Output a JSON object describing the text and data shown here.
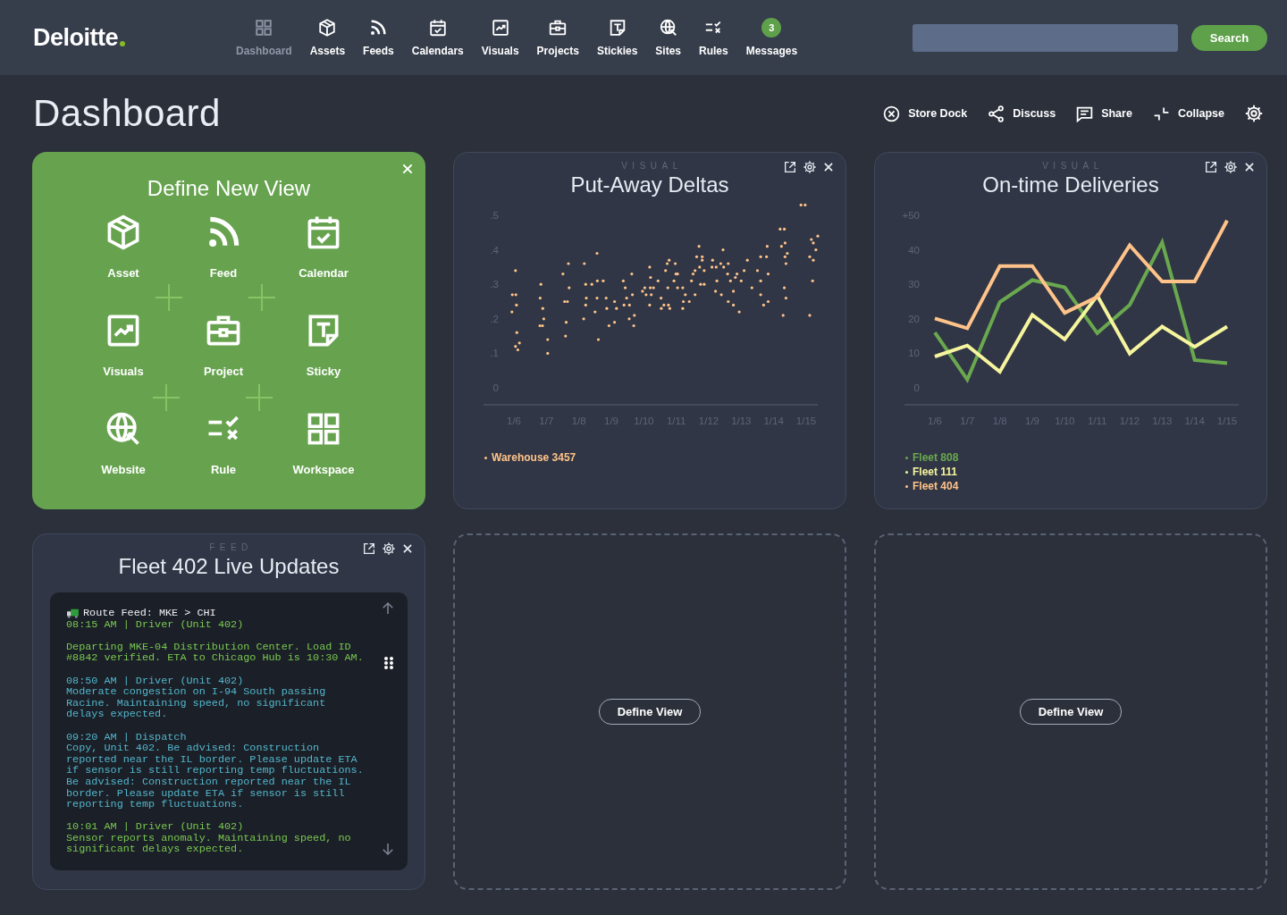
{
  "nav": {
    "logo": "Deloitte",
    "items": [
      {
        "label": "Dashboard",
        "selected": true
      },
      {
        "label": "Assets",
        "selected": false
      },
      {
        "label": "Feeds",
        "selected": false
      },
      {
        "label": "Calendars",
        "selected": false
      },
      {
        "label": "Visuals",
        "selected": false
      },
      {
        "label": "Projects",
        "selected": false
      },
      {
        "label": "Stickies",
        "selected": false
      },
      {
        "label": "Sites",
        "selected": false
      },
      {
        "label": "Rules",
        "selected": false
      },
      {
        "label": "Messages",
        "selected": false,
        "badge": "3"
      }
    ],
    "search_button": "Search"
  },
  "page": {
    "title": "Dashboard",
    "actions": [
      "Store Dock",
      "Discuss",
      "Share",
      "Collapse"
    ]
  },
  "cards": [
    {
      "kind": "picker",
      "title": "Define New View",
      "options": [
        "Asset",
        "Feed",
        "Calendar",
        "Visuals",
        "Project",
        "Sticky",
        "Website",
        "Rule",
        "Workspace"
      ]
    },
    {
      "kind": "chart",
      "eyebrow": "VISUAL",
      "title": "Put-Away Deltas",
      "plot": {
        "kind": "scatter",
        "y_labels": [
          ".5",
          ".4",
          ".3",
          ".2",
          ".1",
          "0"
        ],
        "x_labels": [
          "1/6",
          "1/7",
          "1/8",
          "1/9",
          "1/10",
          "1/11",
          "1/12",
          "1/13",
          "1/14",
          "1/15"
        ],
        "legend": [
          {
            "name": "Warehouse 3457",
            "color": "#ffc38a"
          }
        ]
      }
    },
    {
      "kind": "chart",
      "eyebrow": "VISUAL",
      "title": "On-time Deliveries",
      "chart_data": {
        "type": "line",
        "categories": [
          "1/6",
          "1/7",
          "1/8",
          "1/9",
          "1/10",
          "1/11",
          "1/12",
          "1/13",
          "1/14",
          "1/15"
        ],
        "series": [
          {
            "name": "Fleet 808",
            "color": "#6aa84f",
            "values": [
              16,
              2.3,
              24.8,
              31.2,
              29.1,
              15.8,
              24,
              42.2,
              8,
              7.1
            ]
          },
          {
            "name": "Fleet 111",
            "color": "#f6f59e",
            "values": [
              9,
              12.2,
              4.6,
              21.1,
              14,
              26.7,
              9.9,
              17.7,
              11.8,
              17.7
            ]
          },
          {
            "name": "Fleet 404",
            "color": "#ffc38a",
            "values": [
              20.1,
              17.2,
              35.3,
              35.3,
              21.7,
              26.3,
              41.3,
              30.8,
              30.8,
              48.5
            ]
          }
        ],
        "ylim": [
          -5,
          50
        ],
        "yticks": [
          {
            "value": 0,
            "label": "0"
          },
          {
            "value": 10,
            "label": "10"
          },
          {
            "value": 20,
            "label": "20"
          },
          {
            "value": 30,
            "label": "30"
          },
          {
            "value": 40,
            "label": "40"
          },
          {
            "value": 50,
            "label": "+50"
          }
        ]
      }
    },
    {
      "kind": "feed",
      "eyebrow": "FEED",
      "title": "Fleet 402 Live Updates",
      "feed": {
        "header": "Route Feed: MKE > CHI",
        "paragraphs": [
          {
            "text": "08:15 AM | Driver (Unit 402)",
            "color": "#79c850"
          },
          {
            "text": "Departing MKE-04 Distribution Center. Load ID #8842 verified. ETA to Chicago Hub is 10:30 AM.",
            "color": "#79c850"
          },
          {
            "text": "08:50 AM | Driver (Unit 402)\nModerate congestion on I-94 South passing\nRacine. Maintaining speed, no significant\ndelays expected.",
            "color": "#52b6cc"
          },
          {
            "text": "09:20 AM | Dispatch\nCopy, Unit 402. Be advised: Construction reported near the IL border. Please update ETA if sensor is still reporting temp fluctuations. Be advised: Construction reported near the IL border. Please update ETA if sensor is still reporting temp fluctuations.",
            "color": "#52b6cc"
          },
          {
            "text": "10:01 AM | Driver (Unit 402)\nSensor reports anomaly. Maintaining speed, no significant delays expected.",
            "color": "#79c850"
          }
        ]
      }
    },
    {
      "kind": "empty",
      "button": "Define View"
    },
    {
      "kind": "empty",
      "button": "Define View"
    }
  ]
}
